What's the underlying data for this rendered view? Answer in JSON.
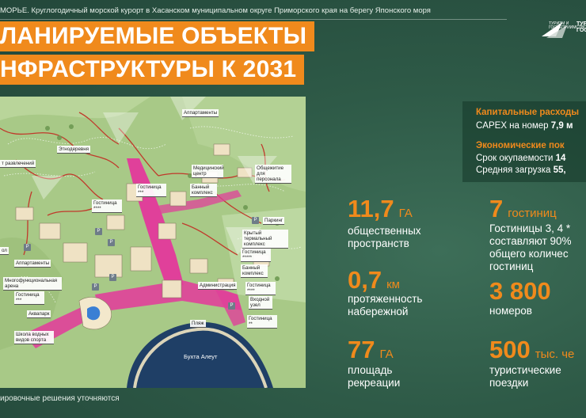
{
  "header": {
    "caption": "МОРЬЕ. Круглогодичный морской курорт в Хасанском муниципальном округе Приморского края на берегу Японского моря",
    "logo_text": "ТУРИЗМ И ГОСТЕПРИИМСТВО",
    "logo_brand": "ТУРИ ГОСТ"
  },
  "title": {
    "line1": "ЛАНИРУЕМЫЕ ОБЪЕКТЫ",
    "line2": "НФРАСТРУКТУРЫ К 2031"
  },
  "map": {
    "labels": {
      "apartments": "Аппартаменты",
      "ethnoderevnya": "Этнодеревня",
      "entertainment": "т развлечений",
      "medical": "Медицинский центр",
      "dormitory": "Общежитие для персонала",
      "bath_complex": "Банный комплекс",
      "hotel_a": "Гостиница ***",
      "hotel_b": "Гостиница ****",
      "parking": "Паркинг",
      "thermal_complex": "Крытый термальный комплекс",
      "hotel_c": "Гостиница *****",
      "apart_hotel": "Аппартаменты",
      "arena": "Многофункциональная арена",
      "hotel_d": "Гостиница ***",
      "administration": "Администрация",
      "bath_complex_2": "Банный комплекс",
      "hotel_e": "Гостиница ****",
      "aquapark": "Аквапарк",
      "water_school": "Школа водных видов спорта",
      "beach": "Пляж",
      "entry_node": "Входной узел",
      "hotel_f": "Гостиница **",
      "bay": "Бухта Алеут",
      "lt": "ол"
    },
    "parking_mark": "P"
  },
  "note": "ировочные решения уточняются",
  "finance": {
    "capex_title": "Капитальные расходы",
    "capex_text": "CAPEX на номер",
    "capex_value": "7,9 м",
    "econ_title": "Экономические пок",
    "payback_text": "Срок окупаемости",
    "payback_value": "14",
    "load_text": "Средняя загрузка",
    "load_value": "55,"
  },
  "stats": [
    {
      "value": "11,7",
      "unit": "ГА",
      "desc1": "общественных",
      "desc2": "пространств"
    },
    {
      "value": "7",
      "unit": "гостиниц",
      "desc1": "Гостиницы 3, 4 *",
      "desc2": "составляют 90%",
      "desc3": "общего количес",
      "desc4": "гостиниц"
    },
    {
      "value": "0,7",
      "unit": "км",
      "desc1": "протяженность",
      "desc2": "набережной"
    },
    {
      "value": "3 800",
      "unit": "",
      "desc1": "номеров",
      "desc2": ""
    },
    {
      "value": "77",
      "unit": "ГА",
      "desc1": "площадь",
      "desc2": "рекреации"
    },
    {
      "value": "500",
      "unit": "тыс. че",
      "desc1": "туристические",
      "desc2": "поездки"
    }
  ],
  "colors": {
    "accent": "#f08a1c",
    "background": "#2e5a47",
    "road_pink": "#e0409a",
    "road_red": "#c0392b",
    "bay": "#1f3f66"
  }
}
